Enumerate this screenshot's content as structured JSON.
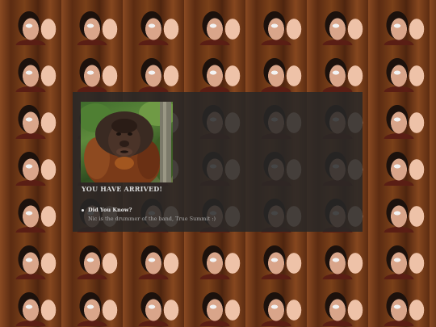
{
  "wallpaper": {
    "description_icon": "tiled-portrait-pattern",
    "colors": {
      "wood": "#6b3516",
      "face": "#d9a58a",
      "hair": "#1c110c"
    }
  },
  "panel": {
    "photo_icon": "orangutan-photo",
    "heading": "YOU HAVE ARRIVED!",
    "facts": [
      {
        "title": "Did You Know?",
        "text": "Nic is the drummer of the band, True Summit :)"
      }
    ],
    "colors": {
      "background": "#282828",
      "heading": "#d9d9d9",
      "text": "#a9a9a9"
    }
  }
}
